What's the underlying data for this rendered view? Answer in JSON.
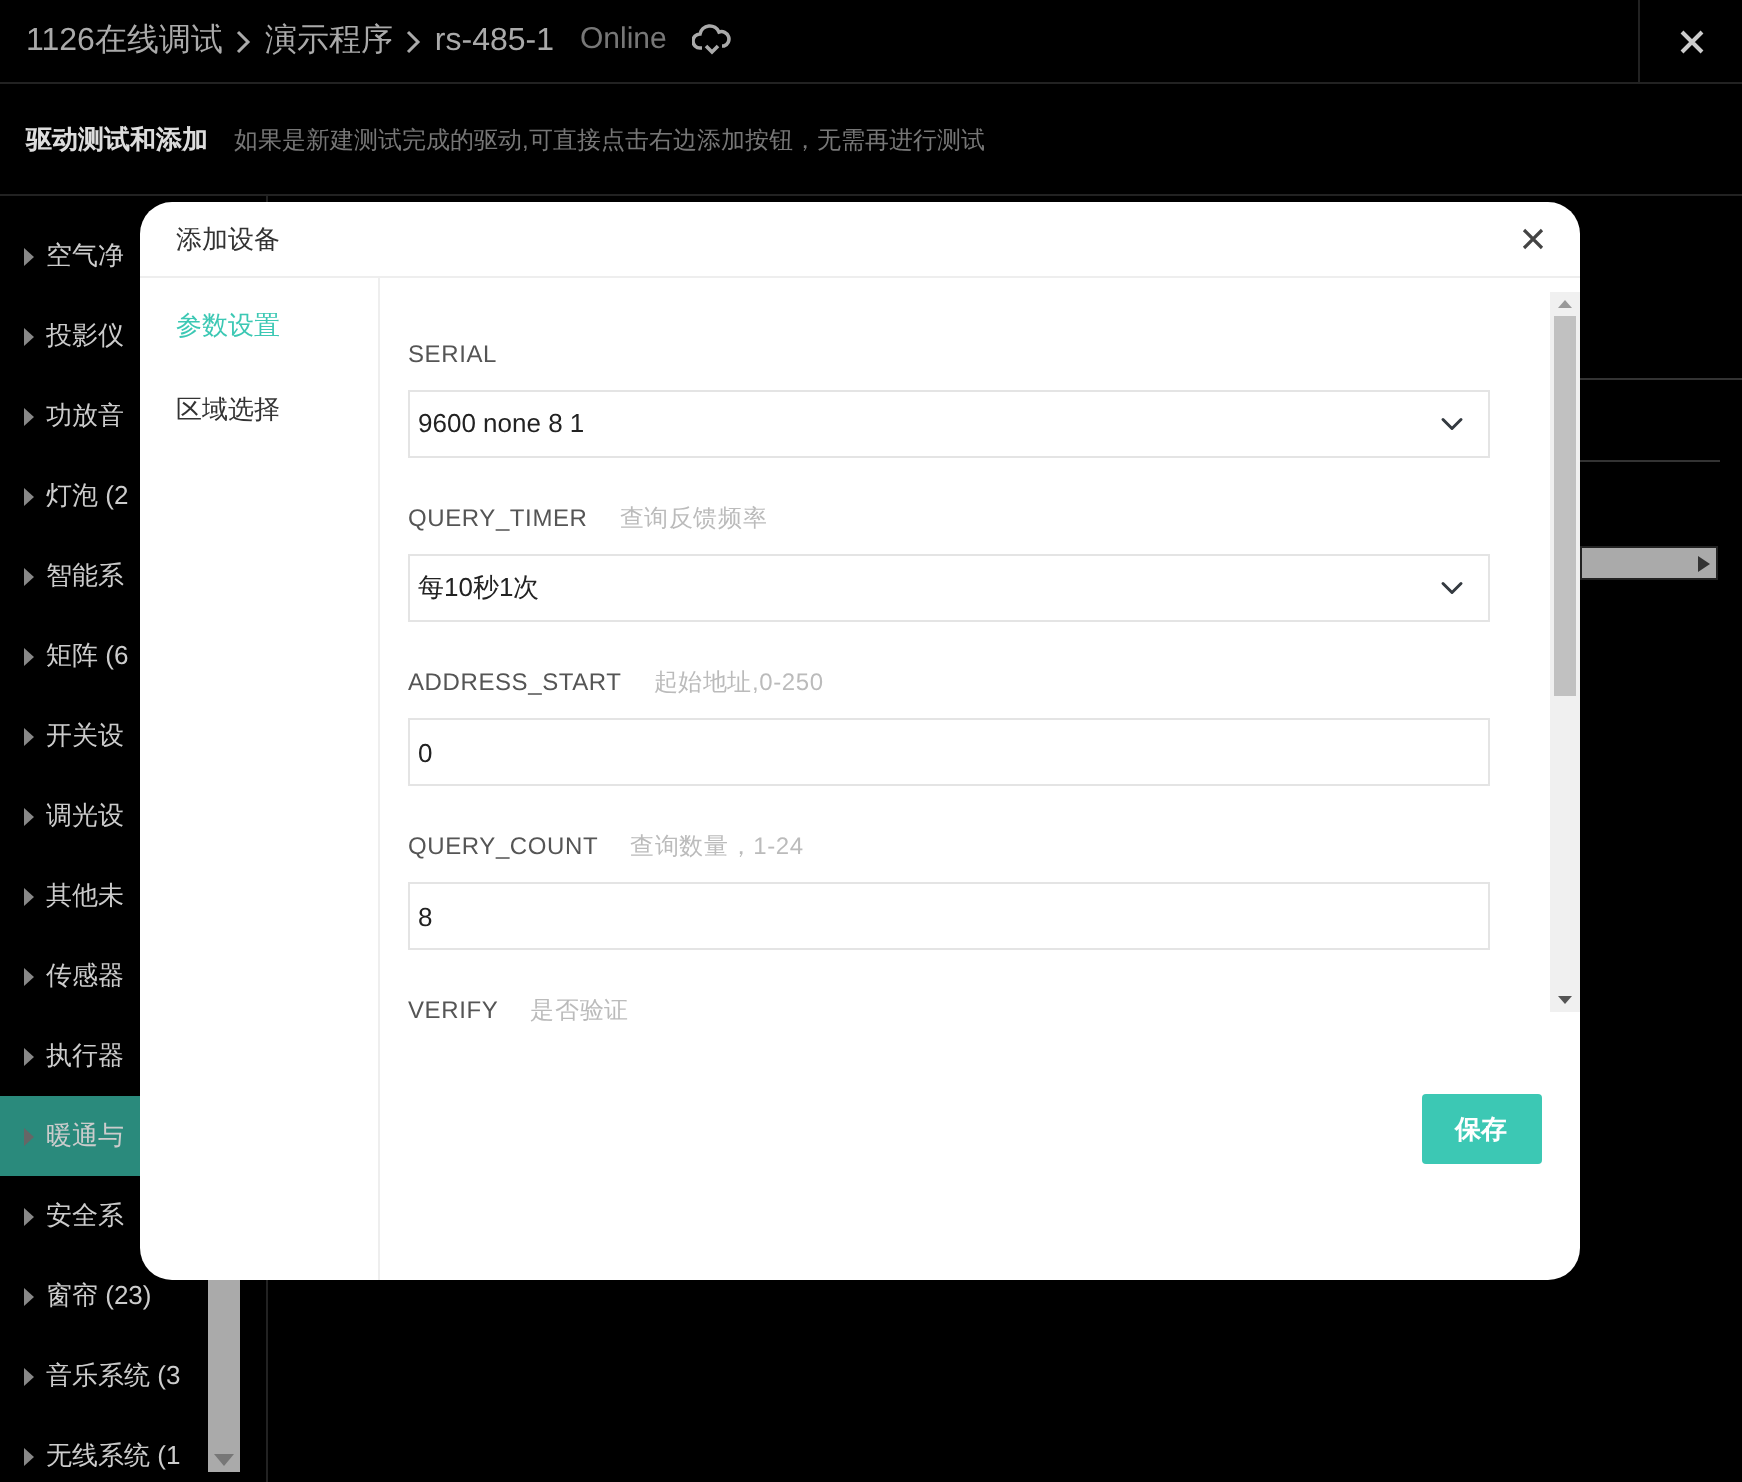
{
  "header": {
    "breadcrumbs": [
      "1126在线调试",
      "演示程序",
      "rs-485-1"
    ],
    "status": "Online"
  },
  "subheader": {
    "title": "驱动测试和添加",
    "hint": "如果是新建测试完成的驱动,可直接点击右边添加按钮，无需再进行测试"
  },
  "sidebar": {
    "items": [
      {
        "label": "空气净",
        "selected": false
      },
      {
        "label": "投影仪",
        "selected": false
      },
      {
        "label": "功放音",
        "selected": false
      },
      {
        "label": "灯泡 (2",
        "selected": false
      },
      {
        "label": "智能系",
        "selected": false
      },
      {
        "label": "矩阵 (6",
        "selected": false
      },
      {
        "label": "开关设",
        "selected": false
      },
      {
        "label": "调光设",
        "selected": false
      },
      {
        "label": "其他未",
        "selected": false
      },
      {
        "label": "传感器",
        "selected": false
      },
      {
        "label": "执行器",
        "selected": false
      },
      {
        "label": "暖通与",
        "selected": true
      },
      {
        "label": "安全系",
        "selected": false
      },
      {
        "label": "窗帘 (23)",
        "selected": false
      },
      {
        "label": "音乐系统 (3",
        "selected": false
      },
      {
        "label": "无线系统 (1",
        "selected": false
      }
    ]
  },
  "modal": {
    "title": "添加设备",
    "tabs": [
      {
        "label": "参数设置",
        "selected": true
      },
      {
        "label": "区域选择",
        "selected": false
      }
    ],
    "fields": [
      {
        "kind": "select",
        "label": "SERIAL",
        "value": "9600 none 8 1"
      },
      {
        "kind": "select",
        "label": "QUERY_TIMER",
        "hint": "查询反馈频率",
        "value": "每10秒1次"
      },
      {
        "kind": "input",
        "label": "ADDRESS_START",
        "hint": "起始地址,0-250",
        "value": "0"
      },
      {
        "kind": "input",
        "label": "QUERY_COUNT",
        "hint": "查询数量，1-24",
        "value": "8"
      },
      {
        "kind": "label",
        "label": "VERIFY",
        "hint": "是否验证"
      }
    ],
    "save_button": "保存"
  }
}
